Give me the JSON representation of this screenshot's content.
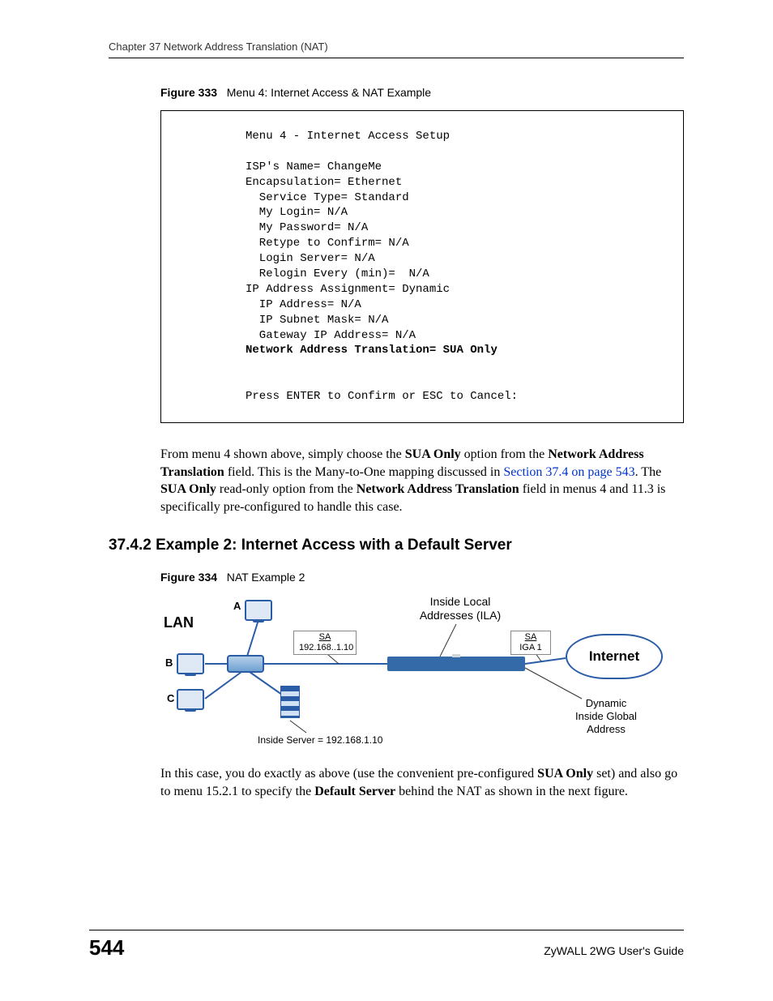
{
  "header": {
    "running_head": "Chapter 37 Network Address Translation (NAT)"
  },
  "figure333": {
    "label": "Figure 333",
    "caption": "Menu 4: Internet Access & NAT Example",
    "terminal": {
      "title": "Menu 4 - Internet Access Setup",
      "isp_name": "ISP's Name= ChangeMe",
      "encapsulation": "Encapsulation= Ethernet",
      "service_type": "  Service Type= Standard",
      "my_login": "  My Login= N/A",
      "my_password": "  My Password= N/A",
      "retype": "  Retype to Confirm= N/A",
      "login_server": "  Login Server= N/A",
      "relogin": "  Relogin Every (min)=  N/A",
      "ip_assignment": "IP Address Assignment= Dynamic",
      "ip_address": "  IP Address= N/A",
      "ip_subnet": "  IP Subnet Mask= N/A",
      "gateway": "  Gateway IP Address= N/A",
      "nat_line": "Network Address Translation= SUA Only",
      "prompt": "Press ENTER to Confirm or ESC to Cancel:"
    }
  },
  "para1": {
    "seg1": "From menu 4 shown above, simply choose the ",
    "bold1": "SUA Only",
    "seg2": " option from the ",
    "bold2": "Network Address Translation",
    "seg3": " field. This is the Many-to-One mapping discussed in ",
    "link": "Section 37.4 on page 543",
    "seg4": ". The ",
    "bold3": "SUA Only",
    "seg5": " read-only option from the ",
    "bold4": "Network Address Translation",
    "seg6": " field in menus 4 and 11.3 is specifically pre-configured to handle this case."
  },
  "section_heading": "37.4.2  Example 2: Internet Access with a Default Server",
  "figure334": {
    "label": "Figure 334",
    "caption": "NAT Example 2",
    "lan": "LAN",
    "hosts": {
      "a": "A",
      "b": "B",
      "c": "C"
    },
    "ila": "Inside Local\nAddresses (ILA)",
    "sa1_top": "SA",
    "sa1_ip": "192.168..1.10",
    "sa2_top": "SA",
    "sa2_sub": "IGA 1",
    "internet": "Internet",
    "dyn": "Dynamic\nInside Global\nAddress",
    "inside_server": "Inside Server = 192.168.1.10"
  },
  "para2": {
    "seg1": "In this case, you do exactly as above (use the convenient pre-configured ",
    "bold1": "SUA Only",
    "seg2": " set) and also go to menu 15.2.1 to specify the ",
    "bold2": "Default Server",
    "seg3": " behind the NAT as shown in the next figure."
  },
  "footer": {
    "page": "544",
    "guide": "ZyWALL 2WG User's Guide"
  }
}
